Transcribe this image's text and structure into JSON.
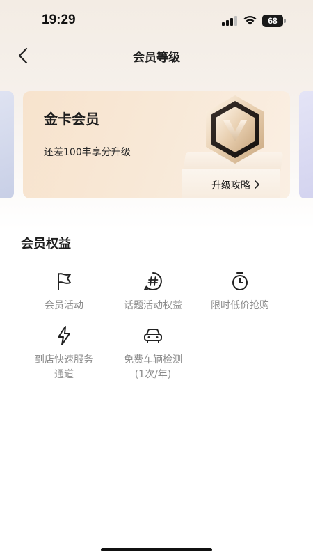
{
  "status_bar": {
    "time": "19:29",
    "battery": "68"
  },
  "nav": {
    "title": "会员等级"
  },
  "card": {
    "tier": "金卡会员",
    "progress_text": "还差100丰享分升级",
    "guide_label": "升级攻略"
  },
  "benefits": {
    "title": "会员权益",
    "items": [
      {
        "label": "会员活动",
        "icon": "flag-icon"
      },
      {
        "label": "话题活动权益",
        "icon": "hashtag-icon"
      },
      {
        "label": "限时低价抢购",
        "icon": "stopwatch-icon"
      },
      {
        "label": "到店快速服务",
        "label_line2": "通道",
        "icon": "lightning-icon"
      },
      {
        "label": "免费车辆检测",
        "label_line2": "(1次/年)",
        "icon": "car-icon"
      }
    ]
  }
}
